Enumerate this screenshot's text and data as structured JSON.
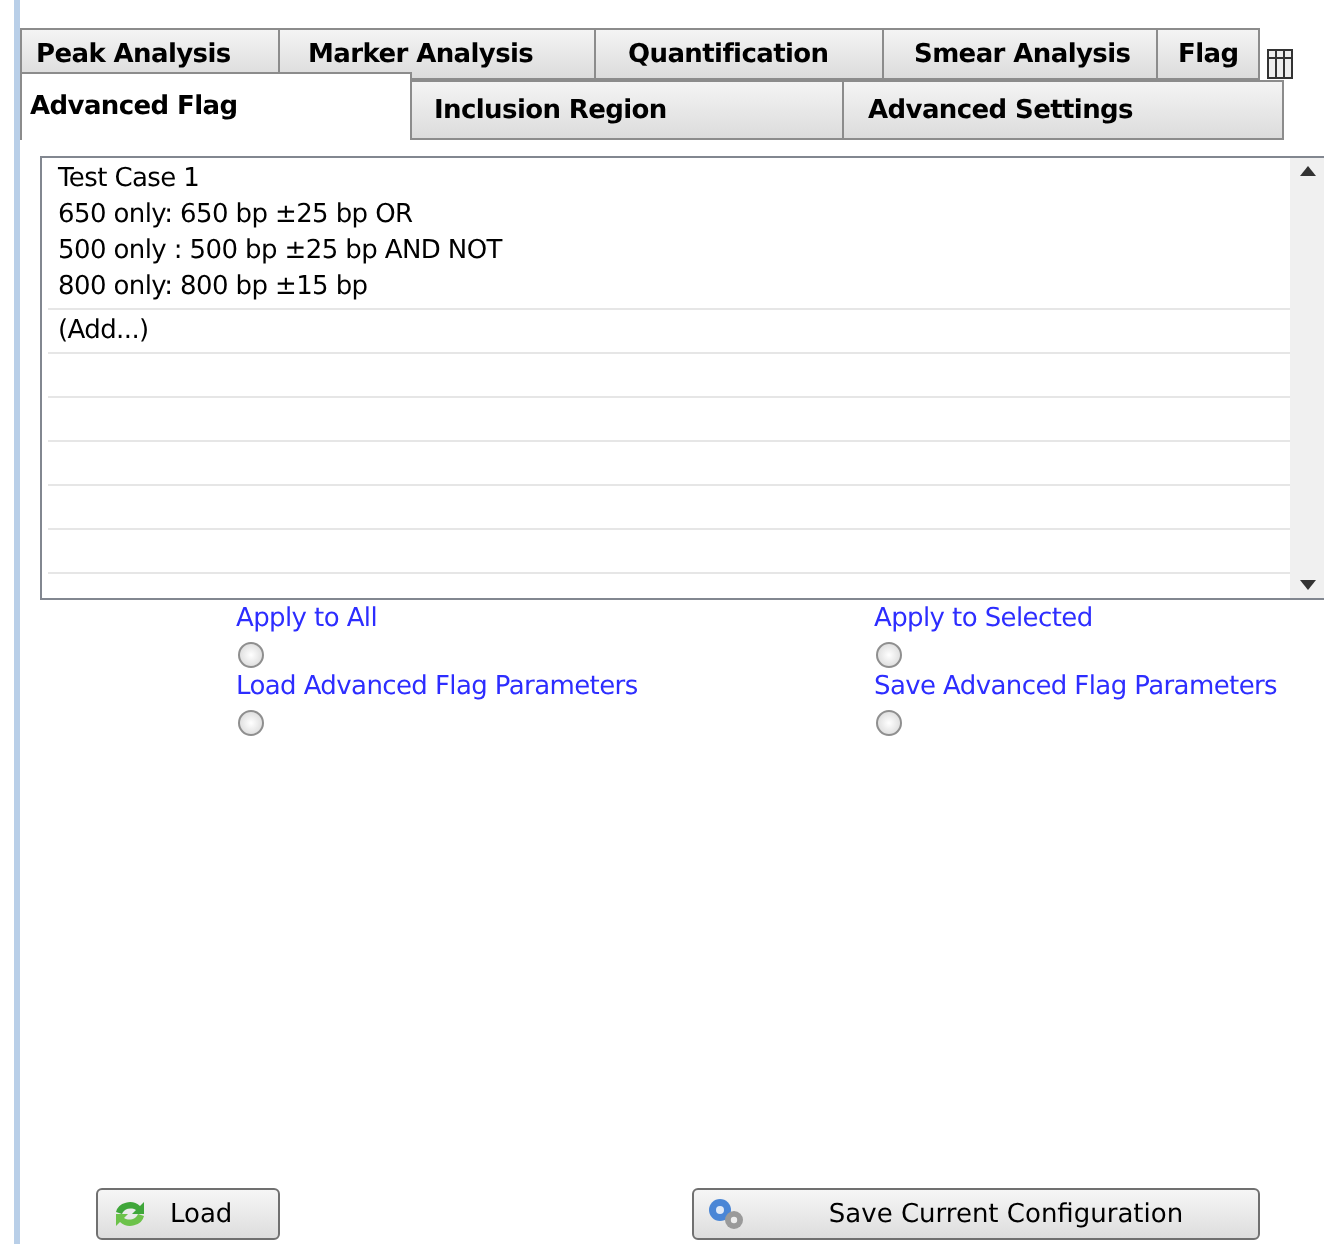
{
  "tab_rows": [
    {
      "tabs": [
        {
          "label": "Peak Analysis",
          "selected": false
        },
        {
          "label": "Marker Analysis",
          "selected": false
        },
        {
          "label": "Quantification",
          "selected": false
        },
        {
          "label": "Smear Analysis",
          "selected": false
        },
        {
          "label": "Flag",
          "selected": false
        }
      ]
    },
    {
      "tabs": [
        {
          "label": "Advanced Flag",
          "selected": true
        },
        {
          "label": "Inclusion Region",
          "selected": false
        },
        {
          "label": "Advanced Settings",
          "selected": false
        }
      ]
    }
  ],
  "list": {
    "items": [
      {
        "lines": [
          "Test Case 1",
          "650 only: 650 bp ±25 bp OR",
          "500 only : 500 bp ±25 bp AND NOT",
          "800 only: 800 bp ±15 bp"
        ]
      },
      {
        "lines": [
          "(Add...)"
        ]
      }
    ]
  },
  "options": [
    {
      "label": "Apply to All",
      "selected": false
    },
    {
      "label": "Apply to Selected",
      "selected": false
    },
    {
      "label": "Load Advanced Flag Parameters",
      "selected": false
    },
    {
      "label": "Save Advanced Flag Parameters",
      "selected": false
    }
  ],
  "buttons": [
    {
      "label": "Load",
      "kind": "load"
    },
    {
      "label": "Save Current Configuration",
      "kind": "save"
    }
  ]
}
